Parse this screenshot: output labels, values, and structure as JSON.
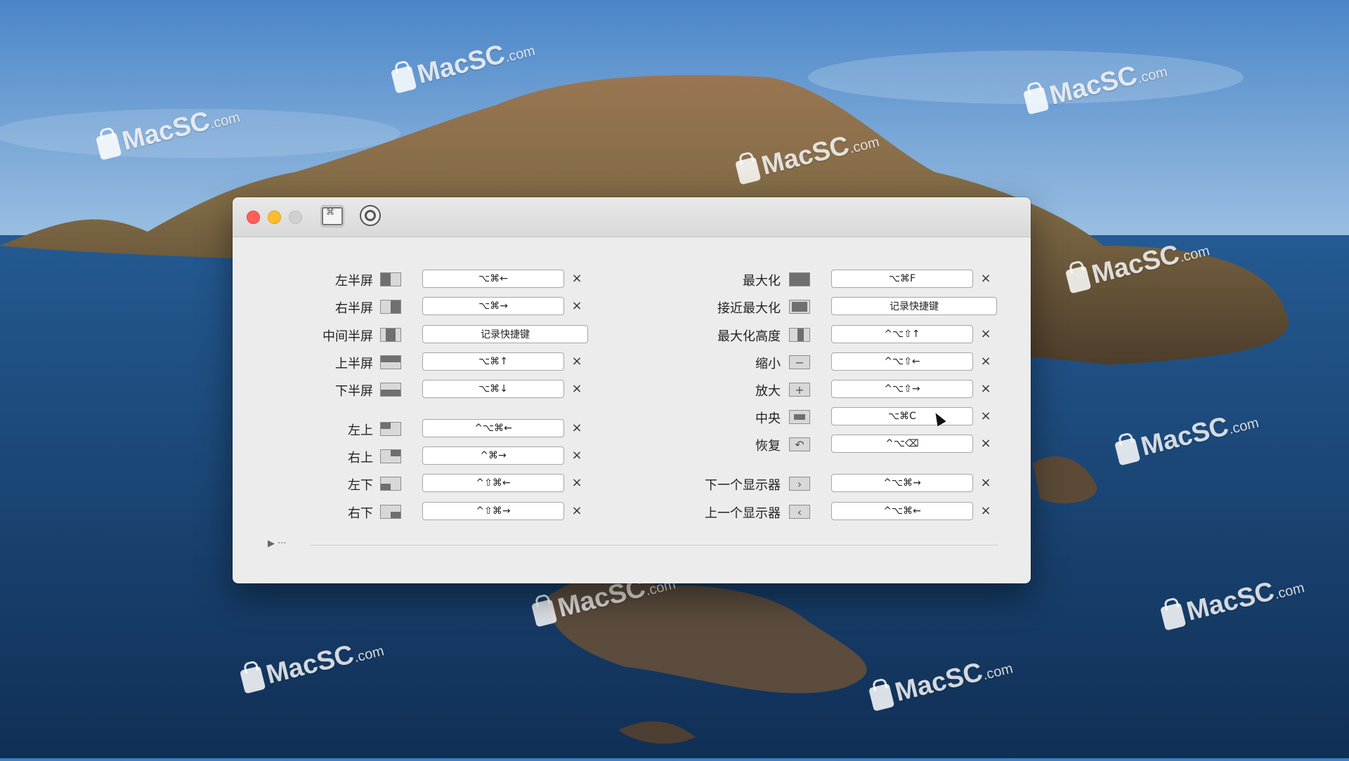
{
  "watermark": {
    "text": "MacSC",
    "suffix": ".com"
  },
  "window": {
    "controls": [
      "close",
      "minimize",
      "zoom"
    ],
    "toolbar": [
      {
        "name": "shortcuts-tab",
        "icon": "keyboard-icon",
        "active": true
      },
      {
        "name": "preferences-tab",
        "icon": "gear-icon",
        "active": false
      }
    ]
  },
  "left": {
    "rows": [
      {
        "label": "左半屏",
        "shortcut": "⌥⌘←",
        "clear": "×",
        "icon": "left-half-icon"
      },
      {
        "label": "右半屏",
        "shortcut": "⌥⌘→",
        "clear": "×",
        "icon": "right-half-icon"
      },
      {
        "label": "中间半屏",
        "shortcut": "记录快捷键",
        "clear": "",
        "icon": "center-half-icon"
      },
      {
        "label": "上半屏",
        "shortcut": "⌥⌘↑",
        "clear": "×",
        "icon": "top-half-icon"
      },
      {
        "label": "下半屏",
        "shortcut": "⌥⌘↓",
        "clear": "×",
        "icon": "bottom-half-icon"
      },
      {
        "label": "左上",
        "shortcut": "^⌥⌘←",
        "clear": "×",
        "icon": "top-left-icon"
      },
      {
        "label": "右上",
        "shortcut": "^⌘→",
        "clear": "×",
        "icon": "top-right-icon"
      },
      {
        "label": "左下",
        "shortcut": "^⇧⌘←",
        "clear": "×",
        "icon": "bottom-left-icon"
      },
      {
        "label": "右下",
        "shortcut": "^⇧⌘→",
        "clear": "×",
        "icon": "bottom-right-icon"
      }
    ]
  },
  "right": {
    "rows": [
      {
        "label": "最大化",
        "shortcut": "⌥⌘F",
        "clear": "×",
        "icon": "maximize-icon"
      },
      {
        "label": "接近最大化",
        "shortcut": "记录快捷键",
        "clear": "",
        "icon": "almost-maximize-icon"
      },
      {
        "label": "最大化高度",
        "shortcut": "^⌥⇧↑",
        "clear": "×",
        "icon": "maximize-height-icon"
      },
      {
        "label": "缩小",
        "shortcut": "^⌥⇧←",
        "clear": "×",
        "icon": "shrink-icon"
      },
      {
        "label": "放大",
        "shortcut": "^⌥⇧→",
        "clear": "×",
        "icon": "enlarge-icon"
      },
      {
        "label": "中央",
        "shortcut": "⌥⌘C",
        "clear": "×",
        "icon": "center-icon"
      },
      {
        "label": "恢复",
        "shortcut": "^⌥⌫",
        "clear": "×",
        "icon": "restore-icon"
      },
      {
        "label": "下一个显示器",
        "shortcut": "^⌥⌘→",
        "clear": "×",
        "icon": "next-display-icon"
      },
      {
        "label": "上一个显示器",
        "shortcut": "^⌥⌘←",
        "clear": "×",
        "icon": "previous-display-icon"
      }
    ]
  },
  "footer": {
    "disclosure": "▶ ···"
  }
}
